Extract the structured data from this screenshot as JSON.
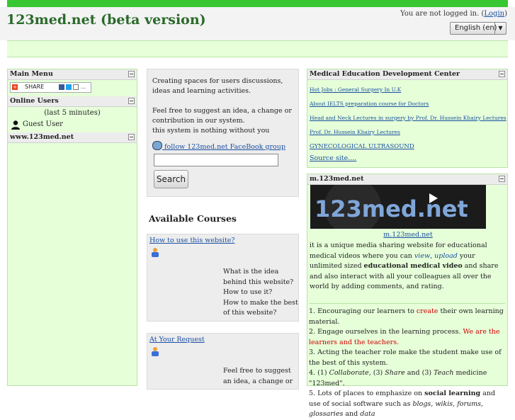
{
  "header": {
    "site_title": "123med.net (beta version)",
    "login_prefix": "You are not logged in. (",
    "login_link": "Login",
    "login_suffix": ")",
    "language": "English (en)"
  },
  "left": {
    "main_menu_title": "Main Menu",
    "share_label": "SHARE",
    "online_users_title": "Online Users",
    "online_users_sub": "(last 5 minutes)",
    "guest_user": "Guest User",
    "site_block_title": "www.123med.net"
  },
  "middle": {
    "intro_1": "Creating spaces for users discussions, ideas and learning activities.",
    "intro_2": "Feel free to suggest an idea, a change or contribution in our system.",
    "intro_3": "this system is nothing without you",
    "fb_link": " follow 123med.net FaceBook group",
    "search_button": "Search",
    "available_courses": "Available Courses",
    "courses": [
      {
        "title": "How to use this website?",
        "desc": [
          "What is the idea behind this website?",
          "How to use it?",
          "How to make the best of this website?"
        ]
      },
      {
        "title": "At Your Request",
        "desc": [
          "Feel free to suggest an idea, a change or"
        ]
      }
    ]
  },
  "right": {
    "med_edu_title": "Medical Education Development Center",
    "med_edu_links": [
      "Hot Jobs : General Surgery In U.K",
      "About IELTS preparation course for Doctors",
      "Head and Neck Lectures in surgery by Prof. Dr. Hussein Khairy Lectures",
      "Prof. Dr. Hussein Khairy Lectures",
      "GYNECOLOGICAL ULTRASOUND",
      "Source site...."
    ],
    "m_block_title": "m.123med.net",
    "banner_text": "123med.net",
    "m_link": "m.123med.net",
    "m_desc": {
      "p1": "it is a unique media sharing website for educational medical videos where you can ",
      "view": "view",
      "comma": ", ",
      "upload": "upload",
      "p2": " your unlimited sized ",
      "bold": "educational medical video",
      "p3": " and share and also interact with all your colleagues all over the world by adding comments, and rating."
    },
    "goals": {
      "g1a": "1. Encouraging our learners to ",
      "g1b": "create",
      "g1c": " their own learning material.",
      "g2a": "2. Engage ourselves in the learning process. ",
      "g2b": "We are the learners and the teachers.",
      "g3": "3. Acting the teacher role make the student make use of the best of this system.",
      "g4a": "4. (1) ",
      "g4b": "Collaborate",
      "g4c": ", (3) ",
      "g4d": "Share",
      "g4e": " and (3) ",
      "g4f": "Teach",
      "g4g": " medicine \"123med\".",
      "g5a": "5. Lots of places to emphasize on ",
      "g5b": "social learning",
      "g5c": " and use of social software such as ",
      "g5d": "blogs, wikis, forums, glossaries",
      "g5e": " and ",
      "g5f": "data"
    }
  },
  "colors": {
    "topbar": "#38c732",
    "block_bg": "#e6ffd9",
    "link": "#1a4fa0",
    "title": "#2a6a2a"
  }
}
